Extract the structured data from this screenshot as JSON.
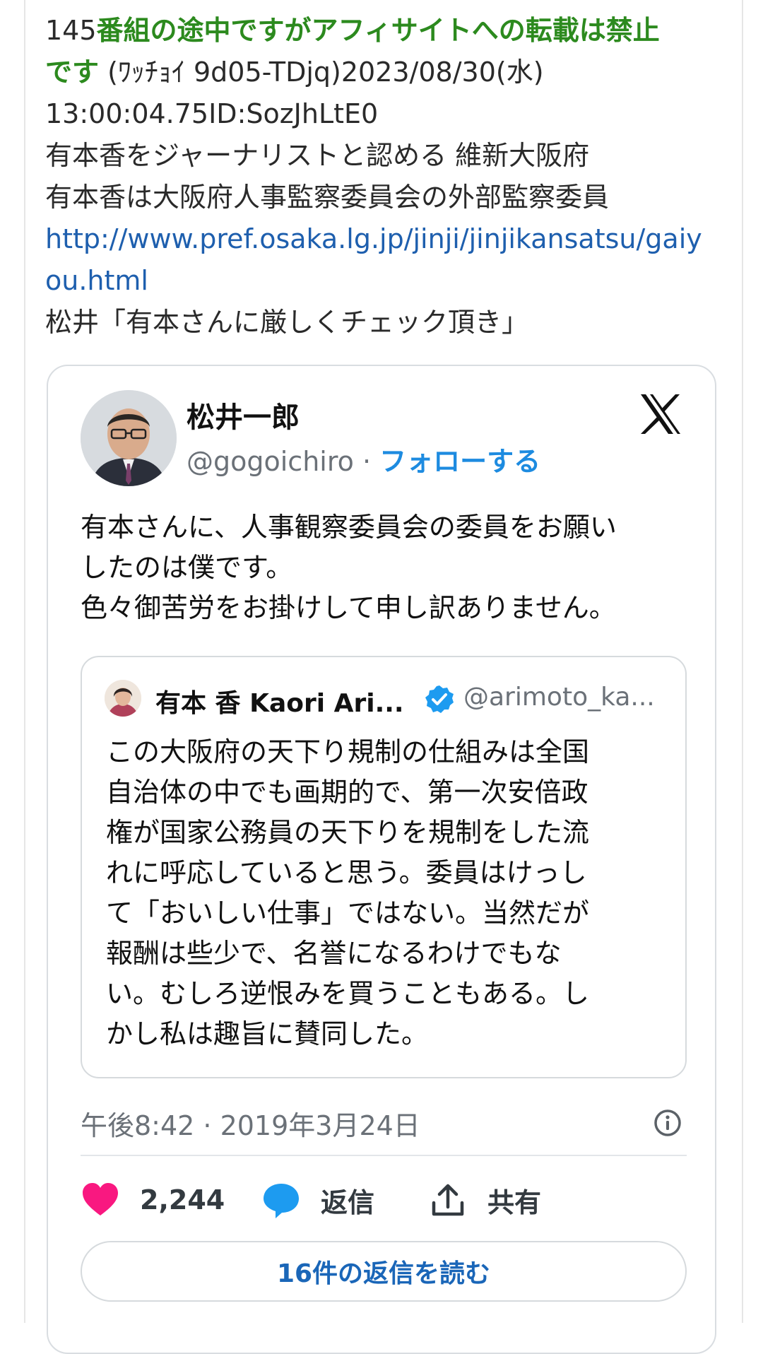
{
  "post": {
    "number": "145",
    "name_line1": "番組の途中ですがアフィサイトへの転載は禁止",
    "name_line2": "です",
    "meta_line2": " (ﾜｯﾁｮｲ 9d05-TDjq)2023/08/30(水)",
    "meta_line3": "13:00:04.75ID:SozJhLtE0",
    "body_line1": "有本香をジャーナリストと認める 維新大阪府",
    "body_line2": "有本香は大阪府人事監察委員会の外部監察委員",
    "link_line1": "http://www.pref.osaka.lg.jp/jinji/jinjikansatsu/gaiy",
    "link_line2": "ou.html",
    "body_line3": "松井「有本さんに厳しくチェック頂き」"
  },
  "tweet": {
    "author_name": "松井一郎",
    "author_handle": "@gogoichiro",
    "separator": " · ",
    "follow_label": "フォローする",
    "text_line1": "有本さんに、人事観察委員会の委員をお願い",
    "text_line2": "したのは僕です。",
    "text_line3": "色々御苦労をお掛けして申し訳ありません。",
    "quote": {
      "name": "有本 香 Kaori Ari...",
      "handle": "@arimoto_ka...",
      "lines": [
        "この大阪府の天下り規制の仕組みは全国",
        "自治体の中でも画期的で、第一次安倍政",
        "権が国家公務員の天下りを規制をした流",
        "れに呼応していると思う。委員はけっし",
        "て「おいしい仕事」ではない。当然だが",
        "報酬は些少で、名誉になるわけでもな",
        "い。むしろ逆恨みを買うこともある。し",
        "かし私は趣旨に賛同した。"
      ]
    },
    "timestamp": "午後8:42 · 2019年3月24日",
    "likes": "2,244",
    "reply_label": "返信",
    "share_label": "共有",
    "read_replies_label": "16件の返信を読む"
  },
  "colors": {
    "name_green": "#2c8a1e",
    "link_blue": "#1e5fae",
    "follow_blue": "#1d8be0",
    "like_pink": "#f91880",
    "reply_blue": "#1d9bf0"
  },
  "icons": [
    "x-logo-icon",
    "verified-badge-icon",
    "info-icon",
    "heart-icon",
    "reply-bubble-icon",
    "share-icon"
  ]
}
